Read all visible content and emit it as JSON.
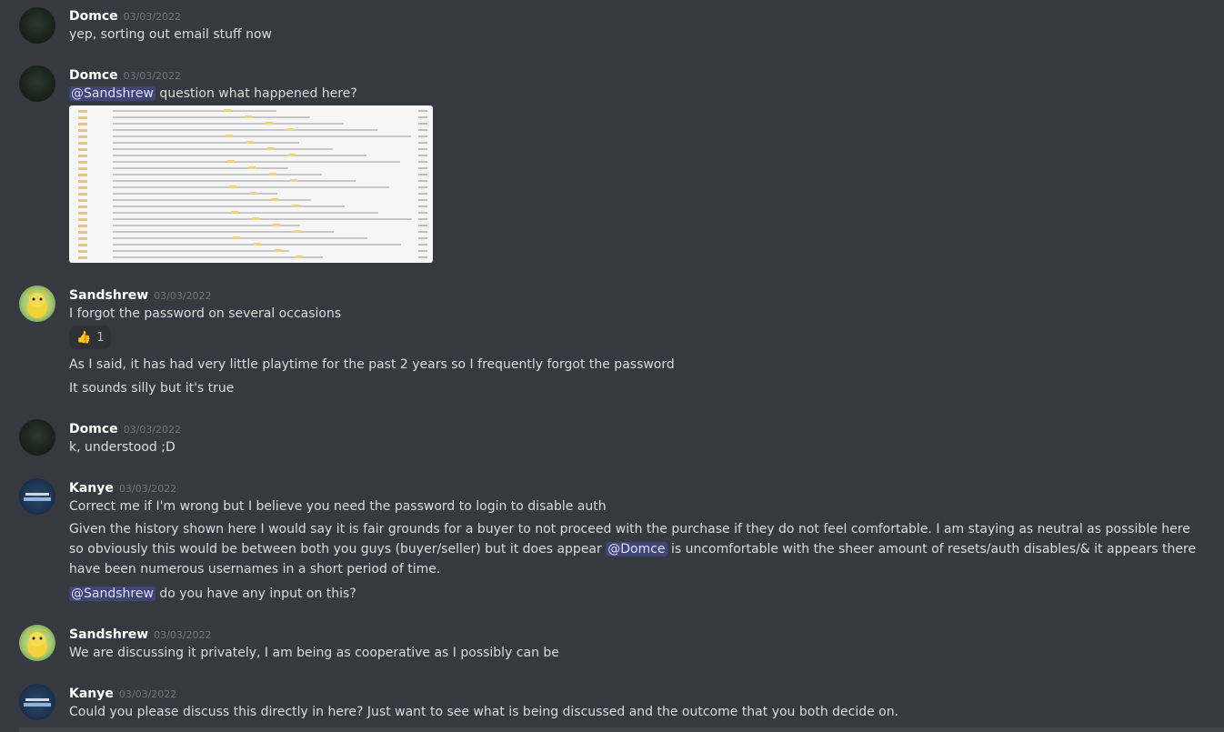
{
  "messages": [
    {
      "username": "Domce",
      "timestamp": "03/03/2022",
      "lines": [
        "yep, sorting out email stuff now"
      ]
    },
    {
      "username": "Domce",
      "timestamp": "03/03/2022",
      "mention": "@Sandshrew",
      "text_after_mention": " question what happened here?"
    },
    {
      "username": "Sandshrew",
      "timestamp": "03/03/2022",
      "lines": [
        "I forgot the password on several occasions",
        "As I said, it has had very little playtime for the past 2 years so I frequently forgot the password",
        "It sounds silly but it's true"
      ],
      "reaction": {
        "emoji": "👍",
        "count": "1"
      }
    },
    {
      "username": "Domce",
      "timestamp": "03/03/2022",
      "lines": [
        "k, understood ;D"
      ]
    },
    {
      "username": "Kanye",
      "timestamp": "03/03/2022",
      "line1": "Correct me if I'm wrong but I believe you need the password to login to disable auth",
      "para_before": "Given the history shown here I would say it is fair grounds for a buyer to not proceed with the purchase if they do not feel comfortable. I am staying as neutral as possible here so obviously this would be between both you guys (buyer/seller) but it does appear ",
      "para_mention": "@Domce",
      "para_after": " is uncomfortable with the sheer amount of resets/auth disables/& it appears there have been numerous usernames in a short period of time.",
      "last_mention": "@Sandshrew",
      "last_after": " do you have any input on this?"
    },
    {
      "username": "Sandshrew",
      "timestamp": "03/03/2022",
      "lines": [
        "We are discussing it privately, I am being as cooperative as I possibly can be"
      ]
    },
    {
      "username": "Kanye",
      "timestamp": "03/03/2022",
      "lines": [
        "Could you please discuss this directly in here? Just want to see what is being discussed and the outcome that you both decide on."
      ]
    }
  ],
  "colors": {
    "background": "#36393f",
    "username": "#ffffff",
    "timestamp": "#72767d",
    "text": "#dcddde",
    "mention_bg": "#3c4270",
    "mention_text": "#dee0fc"
  }
}
